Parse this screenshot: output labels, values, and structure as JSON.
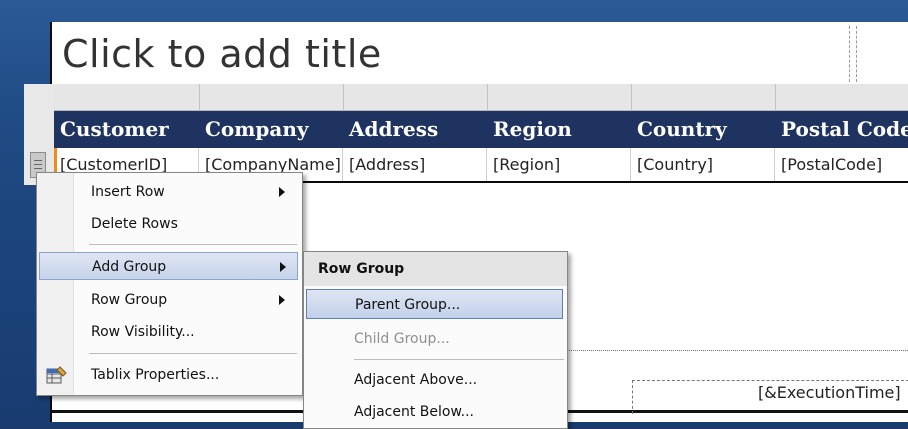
{
  "report": {
    "title_placeholder": "Click to add title",
    "columns": [
      "Customer",
      "Company",
      "Address",
      "Region",
      "Country",
      "Postal Code"
    ],
    "data_row": [
      "[CustomerID]",
      "[CompanyName]",
      "[Address]",
      "[Region]",
      "[Country]",
      "[PostalCode]"
    ],
    "footer_expression": "[&ExecutionTime]"
  },
  "context_menu": {
    "items": [
      {
        "label": "Insert Row",
        "has_submenu": true
      },
      {
        "label": "Delete Rows",
        "has_submenu": false
      },
      {
        "label": "Add Group",
        "has_submenu": true,
        "highlighted": true
      },
      {
        "label": "Row Group",
        "has_submenu": true
      },
      {
        "label": "Row Visibility...",
        "has_submenu": false
      },
      {
        "label": "Tablix Properties...",
        "has_submenu": false,
        "icon": "tablix-properties-icon"
      }
    ]
  },
  "submenu": {
    "header": "Row Group",
    "items": [
      {
        "label": "Parent Group...",
        "highlighted": true,
        "enabled": true
      },
      {
        "label": "Child Group...",
        "enabled": false
      },
      {
        "label": "Adjacent Above...",
        "enabled": true
      },
      {
        "label": "Adjacent Below...",
        "enabled": true
      }
    ]
  },
  "colors": {
    "header_bg": "#1f3361",
    "highlight": "#c6d3ea",
    "background": "#1f4a83"
  }
}
